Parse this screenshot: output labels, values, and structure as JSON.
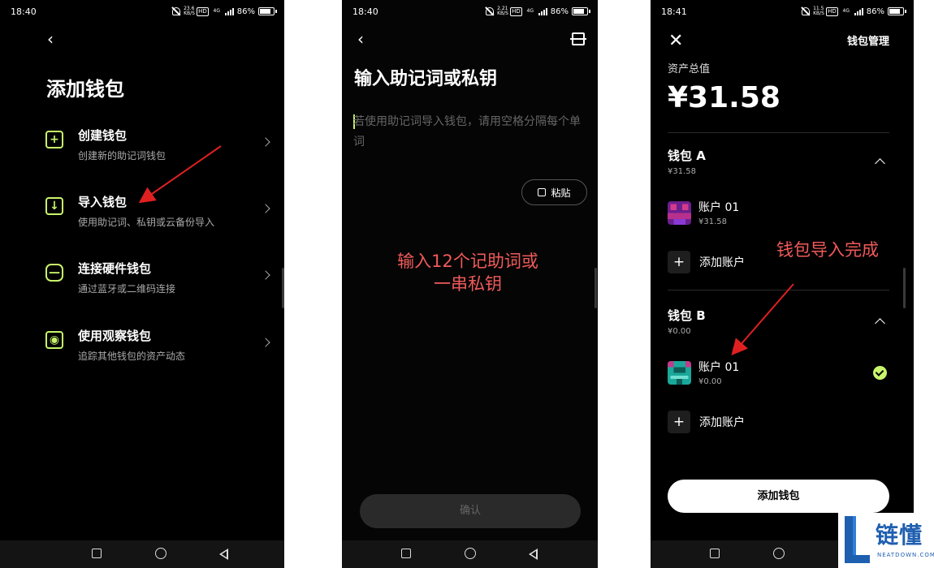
{
  "colors": {
    "accent": "#c9f56b",
    "annotation": "#f05a5a",
    "logo_blue": "#1f5fb0"
  },
  "screen1": {
    "status": {
      "time": "18:40",
      "net": "23.6 KB/S",
      "hd": "HD",
      "gen": "4G",
      "battery": "86%"
    },
    "back_icon": "chevron-left-icon",
    "title": "添加钱包",
    "options": [
      {
        "title": "创建钱包",
        "subtitle": "创建新的助记词钱包",
        "icon": "plus-square-icon"
      },
      {
        "title": "导入钱包",
        "subtitle": "使用助记词、私钥或云备份导入",
        "icon": "import-icon"
      },
      {
        "title": "连接硬件钱包",
        "subtitle": "通过蓝牙或二维码连接",
        "icon": "hardware-wallet-icon"
      },
      {
        "title": "使用观察钱包",
        "subtitle": "追踪其他钱包的资产动态",
        "icon": "eye-icon"
      }
    ]
  },
  "screen2": {
    "status": {
      "time": "18:40",
      "net": "2.21 KB/S",
      "hd": "HD",
      "gen": "4G",
      "battery": "86%"
    },
    "title": "输入助记词或私钥",
    "placeholder": "若使用助记词导入钱包，请用空格分隔每个单词",
    "paste_label": "粘贴",
    "confirm_label": "确认",
    "annotation": [
      "输入12个记助词或",
      "一串私钥"
    ]
  },
  "screen3": {
    "status": {
      "time": "18:41",
      "net": "11.5 KB/S",
      "hd": "HD",
      "gen": "4G",
      "battery": "86%"
    },
    "manage_label": "钱包管理",
    "total_label": "资产总值",
    "total_value": "¥31.58",
    "wallets": [
      {
        "name": "钱包 A",
        "balance": "¥31.58",
        "account": {
          "name": "账户 01",
          "balance": "¥31.58",
          "selected": false
        }
      },
      {
        "name": "钱包 B",
        "balance": "¥0.00",
        "account": {
          "name": "账户 01",
          "balance": "¥0.00",
          "selected": true
        }
      }
    ],
    "add_account_label": "添加账户",
    "add_wallet_label": "添加钱包",
    "annotation": "钱包导入完成"
  },
  "logo": {
    "text": "链懂",
    "sub": "NEATDOWN.COM"
  }
}
